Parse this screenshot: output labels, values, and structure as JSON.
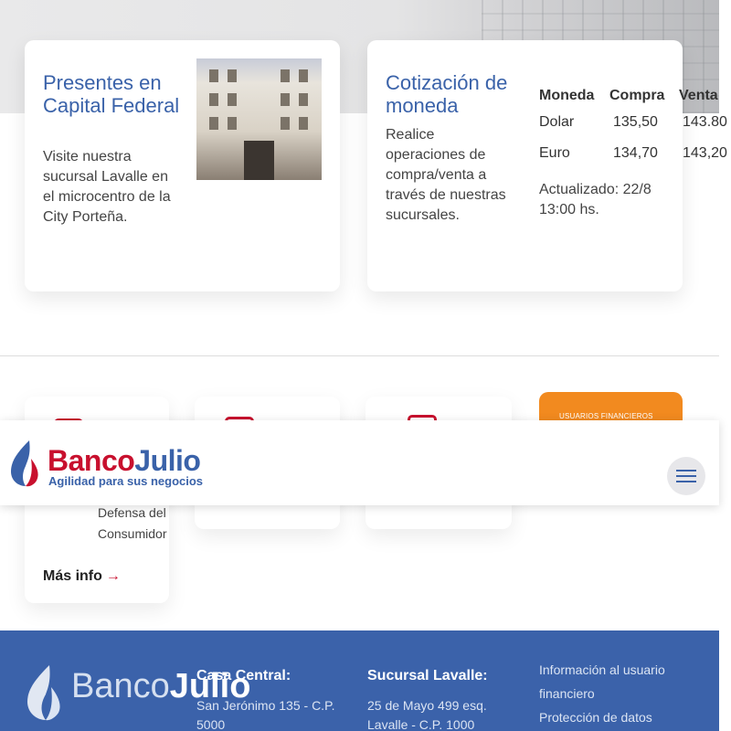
{
  "cards": {
    "capital": {
      "title": "Presentes en Capital Federal",
      "text": "Visite nuestra sucursal Lavalle en el microcentro de la City Porteña."
    },
    "currency": {
      "title": "Cotización de moneda",
      "text": "Realice operaciones de compra/venta a través de nuestras sucursales.",
      "headers": [
        "Moneda",
        "Compra",
        "Venta"
      ],
      "rows": [
        {
          "currency": "Dolar",
          "buy": "135,50",
          "sell": "143.80"
        },
        {
          "currency": "Euro",
          "buy": "134,70",
          "sell": "143,20"
        }
      ],
      "updated": "Actualizado: 22/8 13:00 hs."
    }
  },
  "mid": {
    "consumer_text": "Defensa del Consumidor",
    "more_label": "Más info",
    "more_arrow": "→",
    "promo_label": "USUARIOS FINANCIEROS",
    "colors": {
      "red": "#c8102e",
      "orange": "#f28a1f"
    }
  },
  "navbar": {
    "brand_a": "Banco",
    "brand_b": "Julio",
    "tagline": "Agilidad para sus negocios",
    "menu_icon": "hamburger-icon",
    "colors": {
      "brand_red": "#c8102e",
      "brand_blue": "#3a62a9"
    }
  },
  "footer": {
    "brand_a": "Banco",
    "brand_b": "Julio",
    "casa_title": "Casa Central:",
    "casa_text": "San Jerónimo 135 - C.P. 5000",
    "lavalle_title": "Sucursal Lavalle:",
    "lavalle_text": "25 de Mayo 499 esq. Lavalle - C.P. 1000",
    "links": [
      "Información al usuario financiero",
      "Protección de datos"
    ],
    "bg_color": "#3b62aa"
  }
}
